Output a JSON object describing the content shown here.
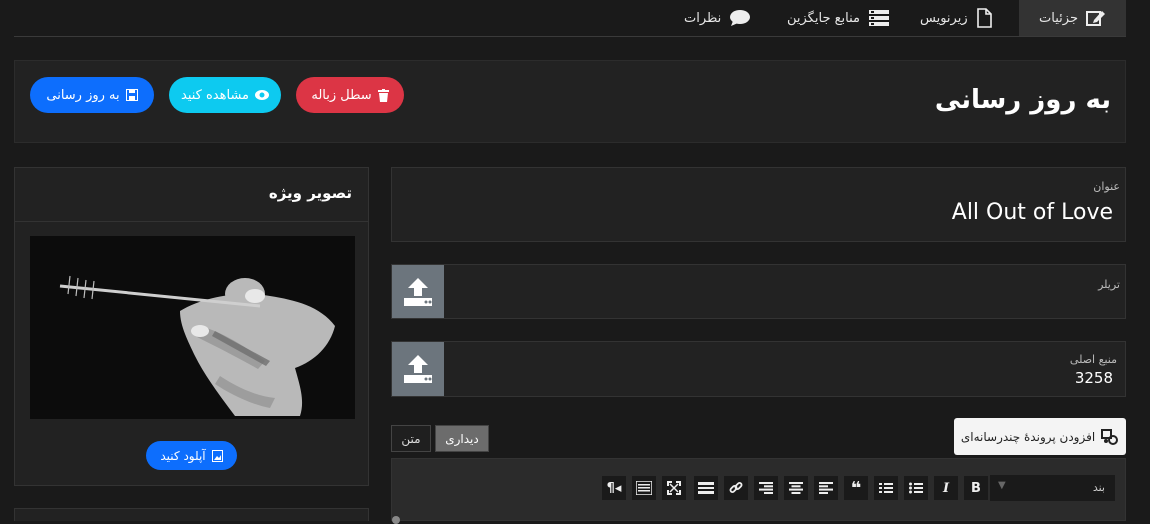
{
  "tabs": [
    {
      "label": "جزئیات",
      "icon": "edit-icon",
      "active": true
    },
    {
      "label": "زیرنویس",
      "icon": "file-icon",
      "active": false
    },
    {
      "label": "منابع جایگزین",
      "icon": "server-icon",
      "active": false
    },
    {
      "label": "نظرات",
      "icon": "comment-icon",
      "active": false
    }
  ],
  "header": {
    "title": "به روز رسانی",
    "trash_label": "سطل زباله",
    "view_label": "مشاهده کنید",
    "update_label": "به روز رسانی"
  },
  "fields": {
    "title_label": "عنوان",
    "title_value": "All Out of Love",
    "trailer_label": "تریلر",
    "trailer_value": "",
    "source_label": "منبع اصلی",
    "source_value": "3258"
  },
  "featured": {
    "heading": "تصویر ویژه",
    "upload_label": "آپلود کنید"
  },
  "editor": {
    "add_media_label": "افزودن پروندهٔ چندرسانه‌ای",
    "visual_tab": "دیداری",
    "text_tab": "متن",
    "paragraph_select": "بند"
  },
  "colors": {
    "background": "#1a1a1a",
    "panel": "#222222",
    "danger": "#dc3545",
    "info": "#0dcaf0",
    "primary": "#0d6efd",
    "upload_box": "#6c757d"
  }
}
